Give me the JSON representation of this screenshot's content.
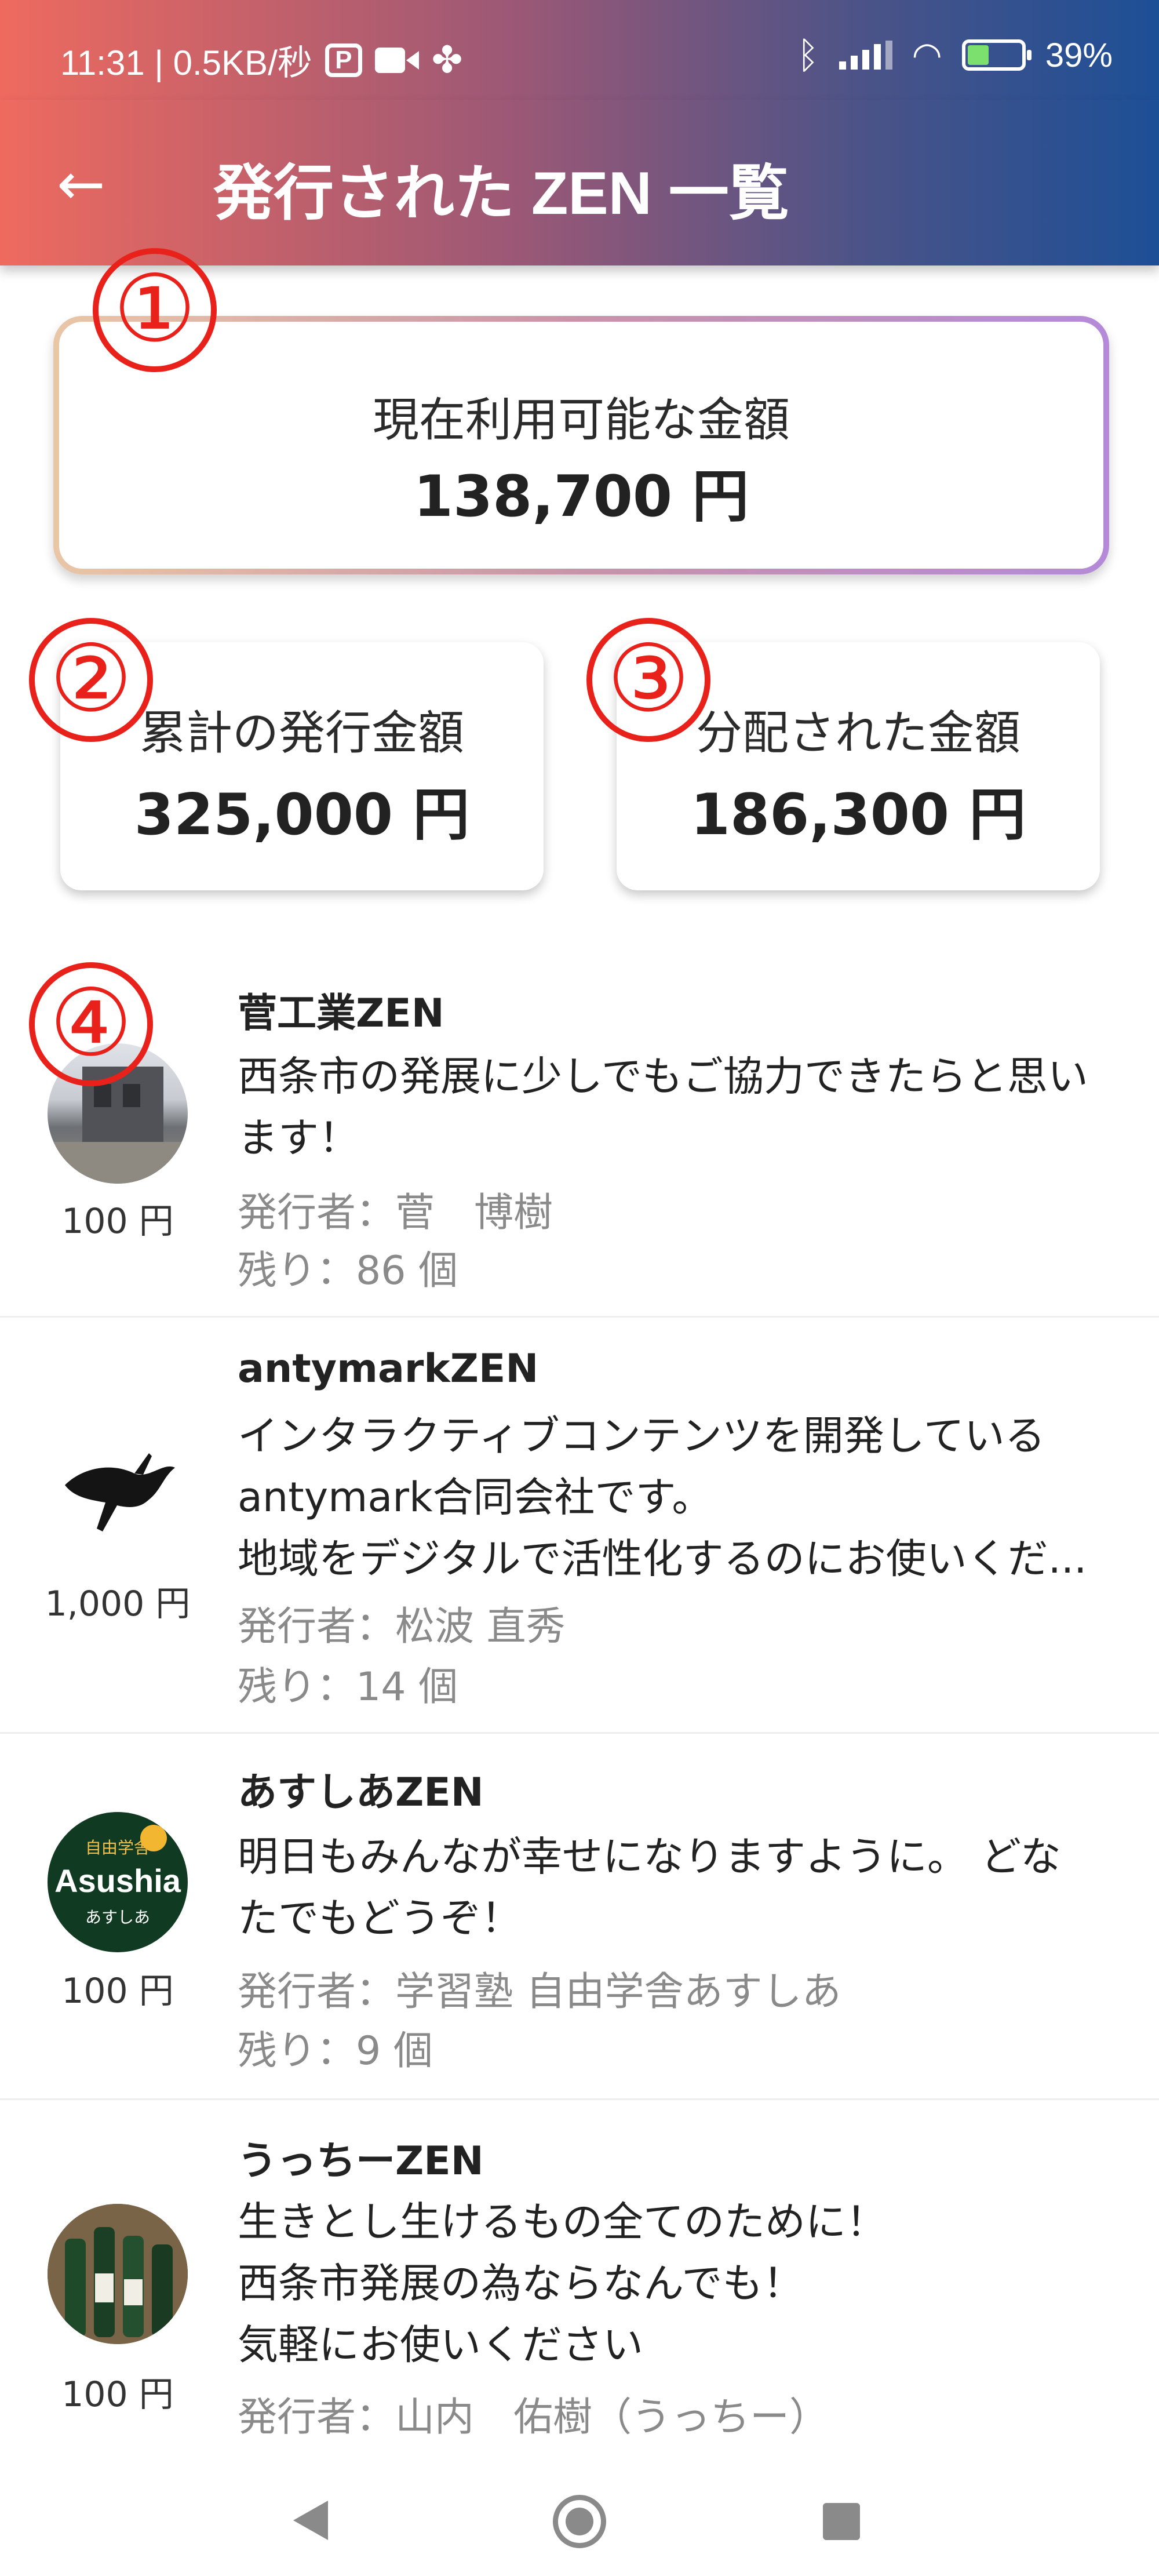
{
  "status_bar": {
    "time_speed": "11:31 | 0.5KB/秒",
    "battery": "39%"
  },
  "app_bar": {
    "title": "発行された ZEN 一覧"
  },
  "summary": {
    "available": {
      "label": "現在利用可能な金額",
      "amount": "138,700 円"
    },
    "issued_total": {
      "label": "累計の発行金額",
      "amount": "325,000 円"
    },
    "distributed": {
      "label": "分配された金額",
      "amount": "186,300 円"
    }
  },
  "annotations": [
    "①",
    "②",
    "③",
    "④"
  ],
  "zen_list": [
    {
      "name": "菅工業ZEN",
      "description": [
        "西条市の発展に少しでもご協力できたらと思い",
        "ます！"
      ],
      "issuer": "発行者：菅　博樹",
      "remaining": "残り：86 個",
      "price": "100 円",
      "avatar": "building-photo"
    },
    {
      "name": "antymarkZEN",
      "description": [
        "インタラクティブコンテンツを開発している",
        "antymark合同会社です。",
        "地域をデジタルで活性化するのにお使いくだ..."
      ],
      "issuer": "発行者：松波 直秀",
      "remaining": "残り：14 個",
      "price": "1,000 円",
      "avatar": "black-bird-logo"
    },
    {
      "name": "あすしあZEN",
      "description": [
        "明日もみんなが幸せになりますように。 どな",
        "たでもどうぞ！"
      ],
      "issuer": "発行者：学習塾 自由学舎あすしあ",
      "remaining": "残り：9 個",
      "price": "100 円",
      "avatar": "asushia-logo",
      "avatar_text": {
        "top": "自由学舎",
        "main": "Asushia",
        "sub": "あすしあ"
      }
    },
    {
      "name": "うっちーZEN",
      "description": [
        "生きとし生けるもの全てのために！",
        "西条市発展の為ならなんでも！",
        "気軽にお使いください"
      ],
      "issuer": "発行者：山内　佑樹（うっちー）",
      "price": "100 円",
      "avatar": "sake-bottles-photo"
    }
  ]
}
